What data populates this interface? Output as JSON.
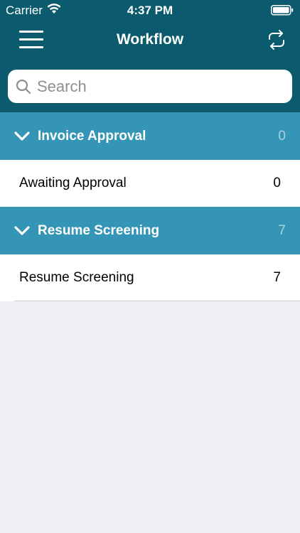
{
  "status_bar": {
    "carrier": "Carrier",
    "time": "4:37 PM",
    "wifi_icon": "wifi-icon",
    "battery_icon": "battery-icon"
  },
  "nav": {
    "title": "Workflow",
    "menu_icon": "hamburger-menu-icon",
    "refresh_icon": "refresh-icon"
  },
  "search": {
    "placeholder": "Search",
    "value": ""
  },
  "sections": [
    {
      "title": "Invoice Approval",
      "count": "0",
      "rows": [
        {
          "label": "Awaiting Approval",
          "count": "0"
        }
      ]
    },
    {
      "title": "Resume Screening",
      "count": "7",
      "rows": [
        {
          "label": "Resume Screening",
          "count": "7"
        }
      ]
    }
  ],
  "colors": {
    "nav_background": "#0b5a6d",
    "section_header": "#3495b6",
    "section_count": "#a9d2e0",
    "page_background": "#efeff4"
  }
}
